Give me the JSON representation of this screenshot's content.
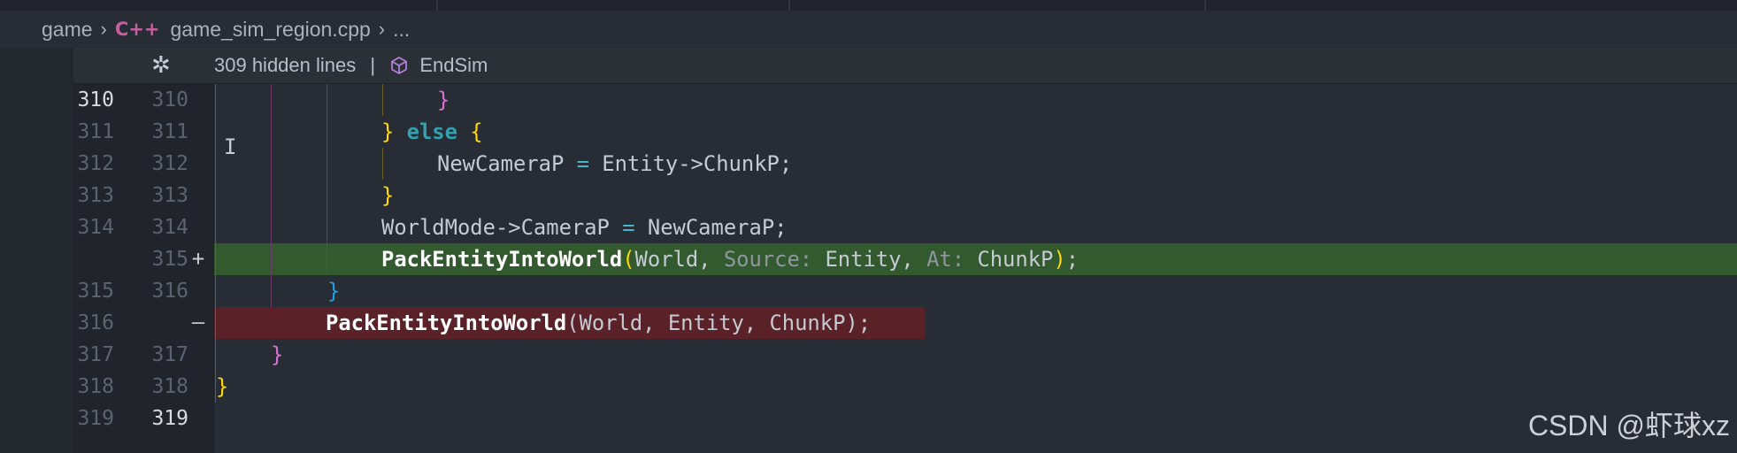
{
  "breadcrumb": {
    "folder": "game",
    "file_icon": "C++",
    "file": "game_sim_region.cpp",
    "symbol": "..."
  },
  "sticky": {
    "hidden_lines": "309 hidden lines",
    "separator": "|",
    "scope": "EndSim"
  },
  "lines": [
    {
      "old": "310",
      "new": "310",
      "mark": ""
    },
    {
      "old": "311",
      "new": "311",
      "mark": ""
    },
    {
      "old": "312",
      "new": "312",
      "mark": ""
    },
    {
      "old": "313",
      "new": "313",
      "mark": ""
    },
    {
      "old": "314",
      "new": "314",
      "mark": ""
    },
    {
      "old": "",
      "new": "315",
      "mark": "+"
    },
    {
      "old": "315",
      "new": "316",
      "mark": ""
    },
    {
      "old": "316",
      "new": "",
      "mark": "—"
    },
    {
      "old": "317",
      "new": "317",
      "mark": ""
    },
    {
      "old": "318",
      "new": "318",
      "mark": ""
    },
    {
      "old": "319",
      "new": "319",
      "mark": ""
    }
  ],
  "code": {
    "l0": {
      "brace": "}"
    },
    "l1": {
      "close": "}",
      "else_kw": "else",
      "open": "{"
    },
    "l2": {
      "lhs": "NewCameraP",
      "eq": "=",
      "rhs": "Entity->ChunkP;"
    },
    "l3": {
      "close": "}"
    },
    "l4": {
      "lhs": "WorldMode->CameraP",
      "eq": "=",
      "rhs": "NewCameraP;"
    },
    "l5": {
      "fn": "PackEntityIntoWorld",
      "p_open": "(",
      "a1": "World,",
      "h1": "Source:",
      "a2": "Entity,",
      "h2": "At:",
      "a3": "ChunkP",
      "p_close": ")",
      "semi": ";"
    },
    "l6": {
      "close": "}"
    },
    "l7": {
      "fn": "PackEntityIntoWorld",
      "args": "(World, Entity, ChunkP);"
    },
    "l8": {
      "close": "}"
    },
    "l9": {
      "close": "}"
    }
  },
  "watermark": "CSDN @虾球xz"
}
